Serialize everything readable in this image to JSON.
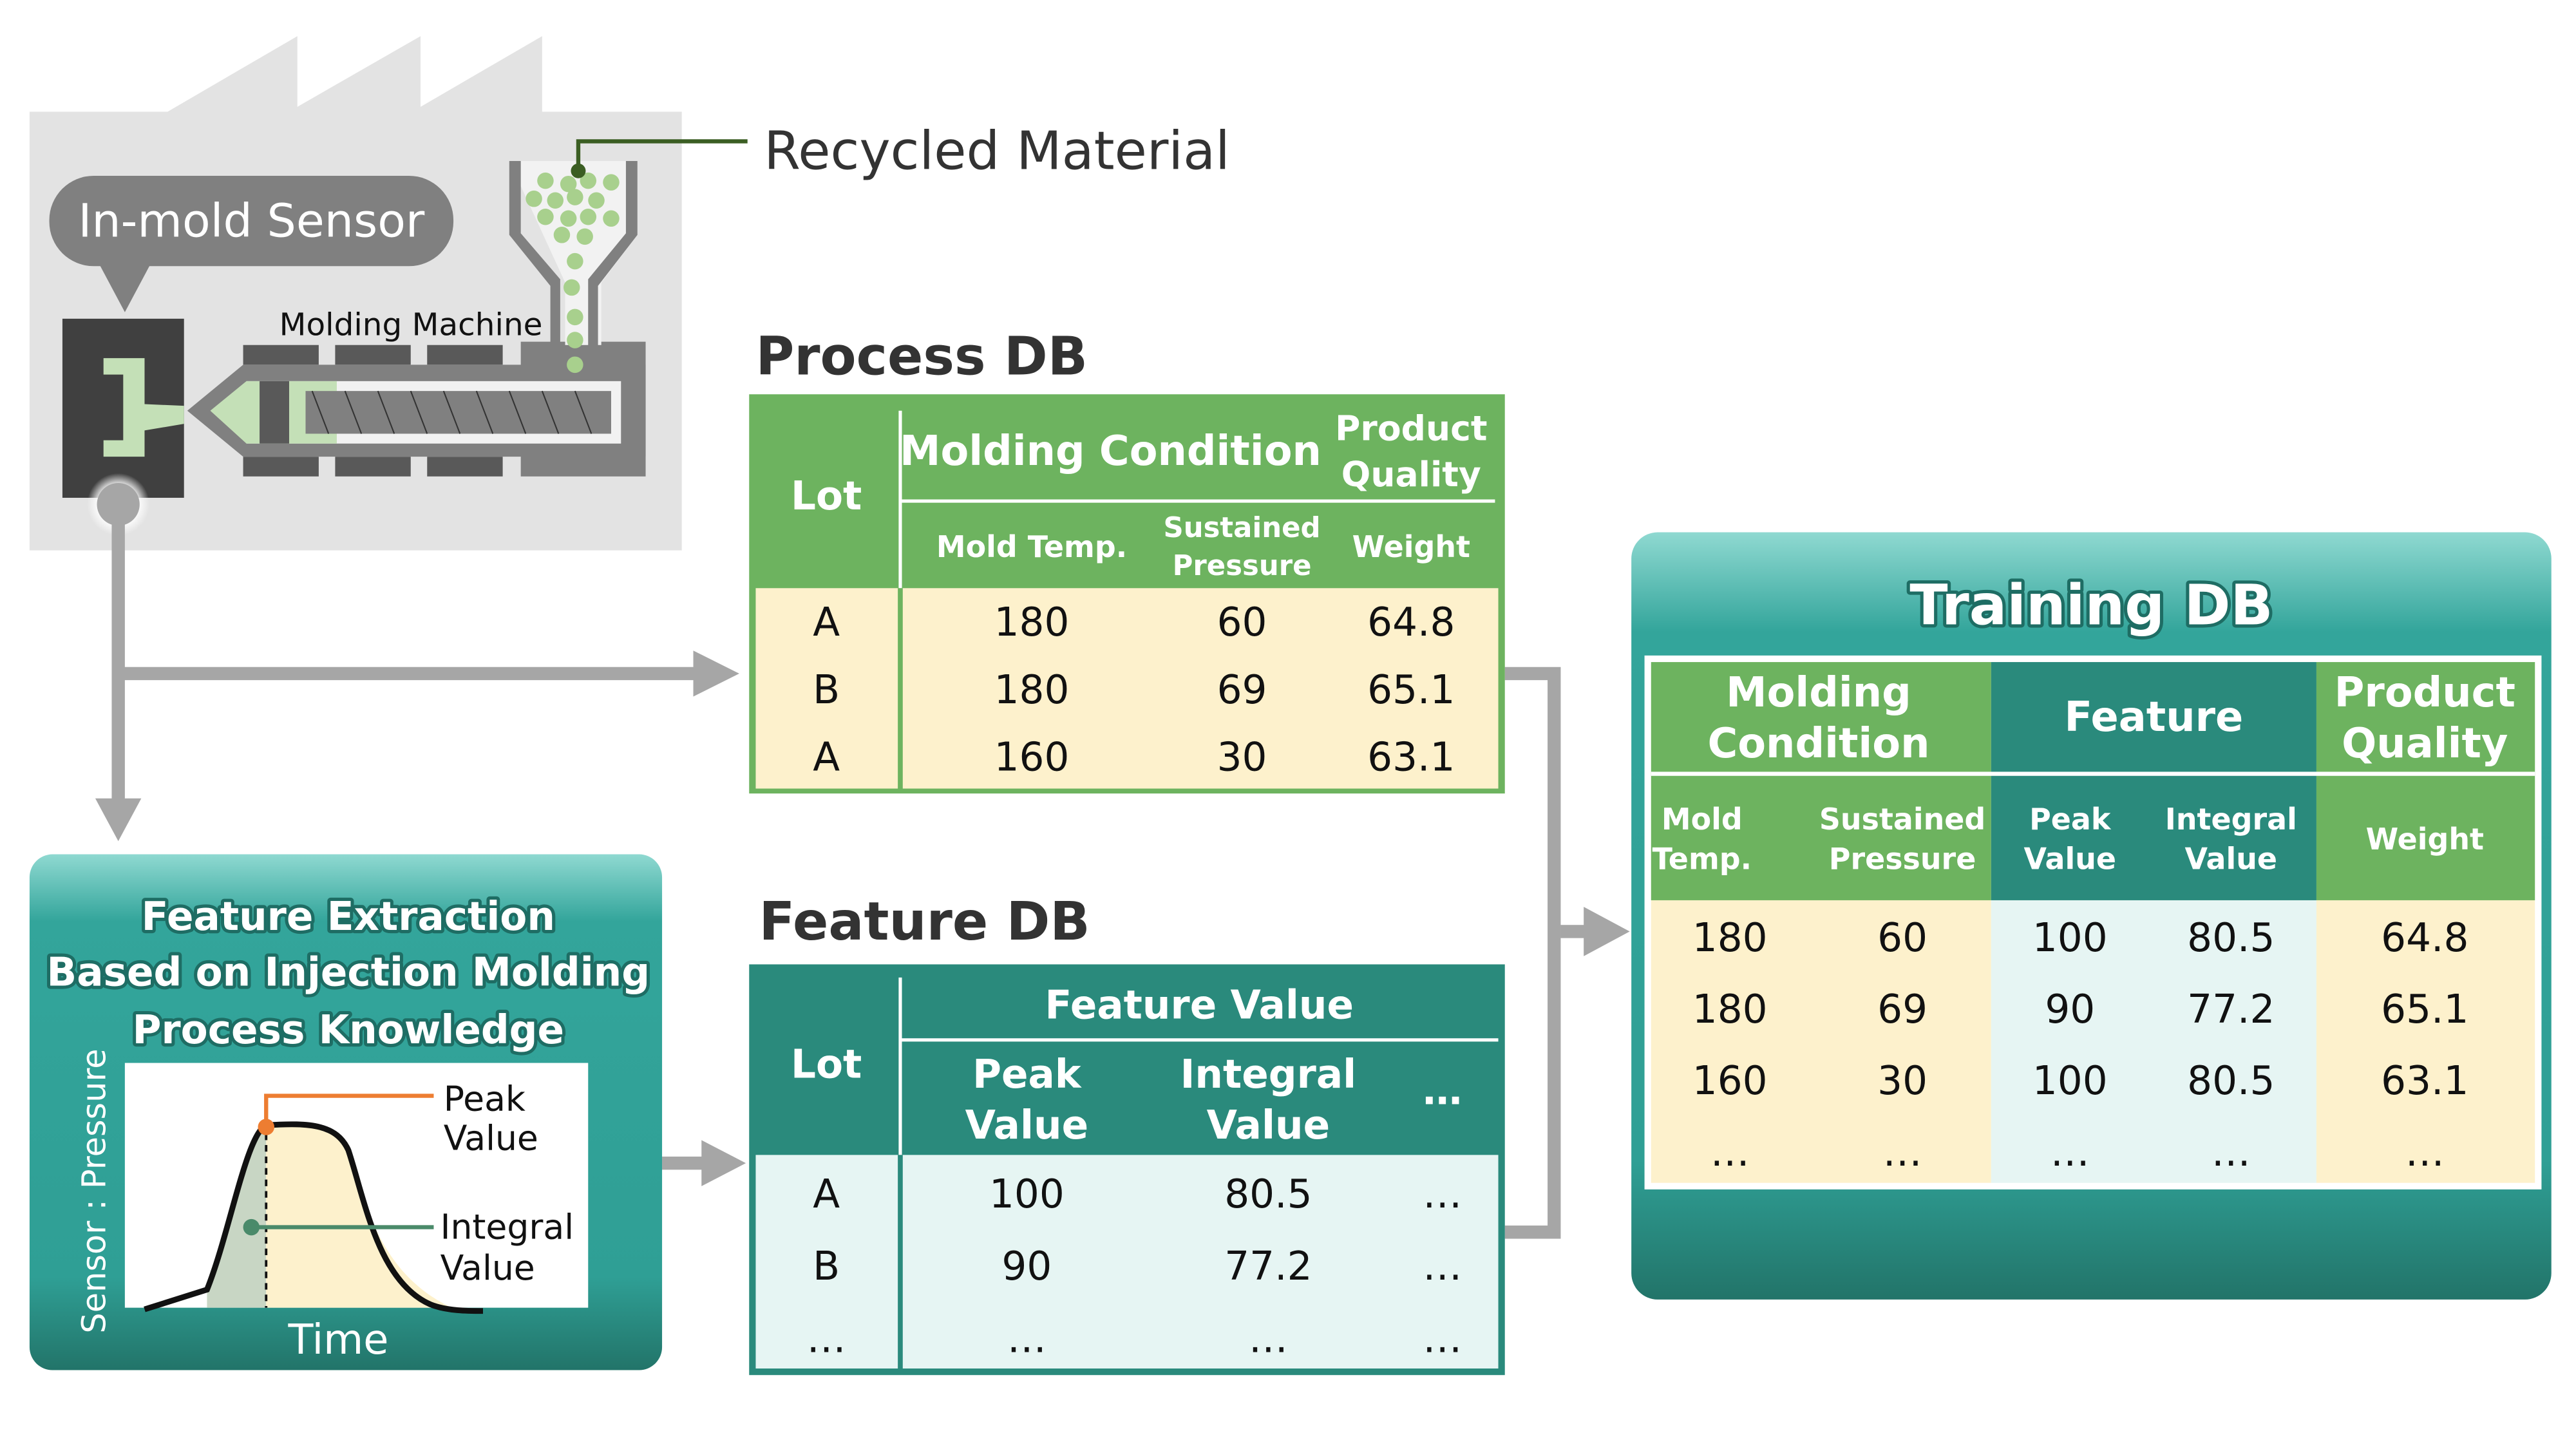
{
  "colors": {
    "green_header": "#6db35f",
    "teal_header": "#2a8a7c",
    "cream_cell": "#fdf1cc",
    "cyan_cell": "#e6f5f3",
    "arrow_gray": "#a6a6a6",
    "dark_green_leader": "#3b5e23",
    "peak_orange": "#ed7d31",
    "integral_green": "#4a8a6a"
  },
  "factory": {
    "sensor_label": "In-mold Sensor",
    "machine_label": "Molding Machine",
    "material_label": "Recycled Material"
  },
  "process_db": {
    "title": "Process DB",
    "headers": {
      "lot": "Lot",
      "molding_condition": "Molding Condition",
      "product_quality_1": "Product",
      "product_quality_2": "Quality",
      "mold_temp": "Mold Temp.",
      "sustained_1": "Sustained",
      "sustained_2": "Pressure",
      "weight": "Weight"
    },
    "rows": [
      [
        "A",
        "180",
        "60",
        "64.8"
      ],
      [
        "B",
        "180",
        "69",
        "65.1"
      ],
      [
        "A",
        "160",
        "30",
        "63.1"
      ]
    ]
  },
  "feature_db": {
    "title": "Feature DB",
    "headers": {
      "lot": "Lot",
      "feature_value": "Feature Value",
      "peak_1": "Peak",
      "peak_2": "Value",
      "integral_1": "Integral",
      "integral_2": "Value",
      "more": "…"
    },
    "rows": [
      [
        "A",
        "100",
        "80.5",
        "…"
      ],
      [
        "B",
        "90",
        "77.2",
        "…"
      ],
      [
        "…",
        "…",
        "…",
        "…"
      ]
    ]
  },
  "feature_extraction": {
    "title_lines": [
      "Feature Extraction",
      "Based on Injection Molding",
      "Process Knowledge"
    ],
    "y_axis_label": "Sensor : Pressure",
    "x_axis_label": "Time",
    "peak_label": [
      "Peak",
      "Value"
    ],
    "integral_label": [
      "Integral",
      "Value"
    ]
  },
  "training_db": {
    "title": "Training DB",
    "groups": {
      "molding_condition": [
        "Molding",
        "Condition"
      ],
      "feature": "Feature",
      "product_quality": [
        "Product",
        "Quality"
      ]
    },
    "subheaders": [
      [
        "Mold",
        "Temp."
      ],
      [
        "Sustained",
        "Pressure"
      ],
      [
        "Peak",
        "Value"
      ],
      [
        "Integral",
        "Value"
      ],
      [
        "Weight",
        ""
      ]
    ],
    "rows": [
      [
        "180",
        "60",
        "100",
        "80.5",
        "64.8"
      ],
      [
        "180",
        "69",
        "90",
        "77.2",
        "65.1"
      ],
      [
        "160",
        "30",
        "100",
        "80.5",
        "63.1"
      ],
      [
        "…",
        "…",
        "…",
        "…",
        "…"
      ]
    ]
  }
}
